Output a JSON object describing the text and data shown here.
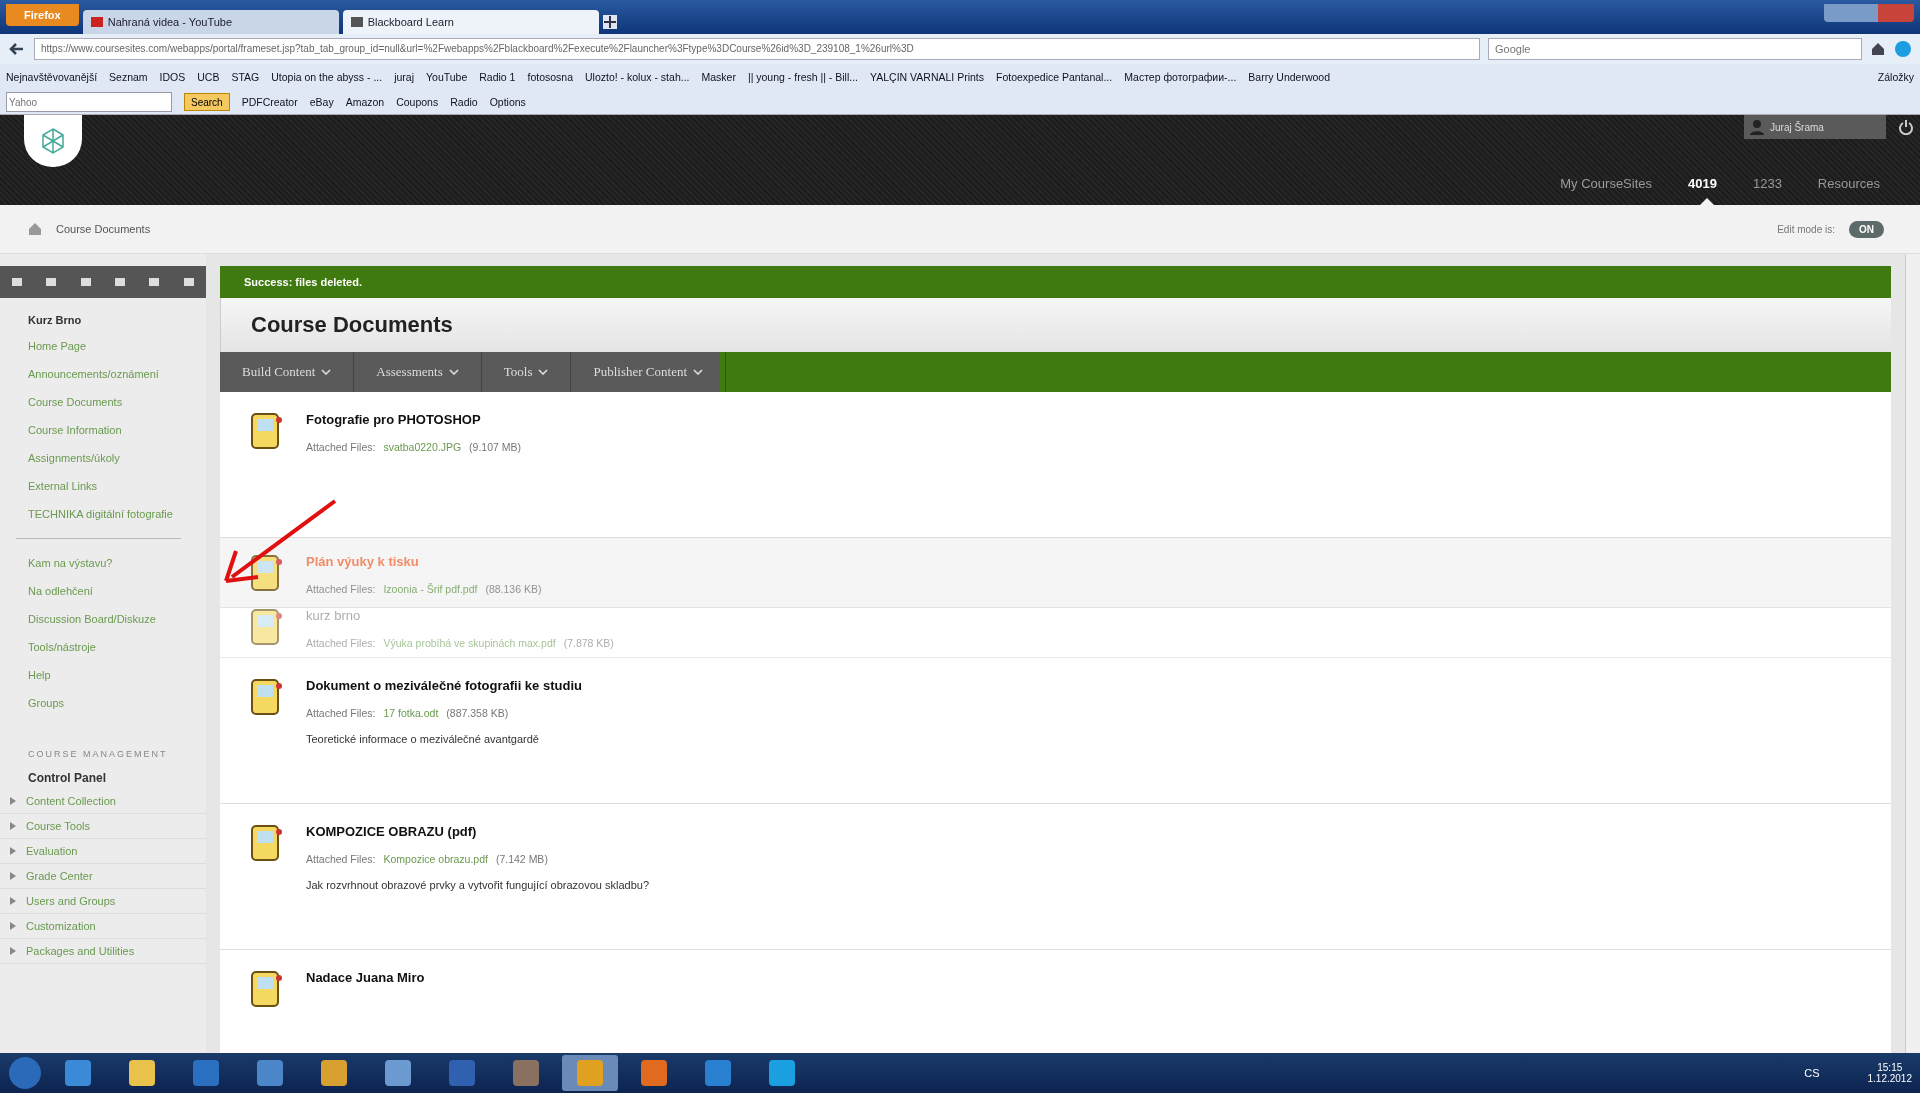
{
  "browser": {
    "menu_button": "Firefox",
    "tabs": [
      {
        "title": "Nahraná videa - YouTube",
        "selected": false
      },
      {
        "title": "Blackboard Learn",
        "selected": true
      }
    ],
    "url": "https://www.coursesites.com/webapps/portal/frameset.jsp?tab_tab_group_id=null&url=%2Fwebapps%2Fblackboard%2Fexecute%2Flauncher%3Ftype%3DCourse%26id%3D_239108_1%26url%3D",
    "search_placeholder": "Google",
    "bookmarks": [
      "Nejnavštěvovanější",
      "Seznam",
      "IDOS",
      "UCB",
      "STAG",
      "Utopia on the abyss - ...",
      "juraj",
      "YouTube",
      "Radio 1",
      "fotososna",
      "Ulozto! - kolux - stah...",
      "Masker",
      "|| young - fresh || - Bill...",
      "YALÇIN VARNALI Prints",
      "Fotoexpedice Pantanal...",
      "Мастер фотографии-...",
      "Barry Underwood"
    ],
    "bookmarks_more": "Záložky",
    "toolbar2": {
      "field_placeholder": "Yahoo",
      "search_button": "Search",
      "items": [
        "PDFCreator",
        "eBay",
        "Amazon",
        "Coupons",
        "Radio",
        "Options"
      ]
    }
  },
  "header": {
    "user": "Juraj Šrama",
    "nav": [
      {
        "label": "My CourseSites",
        "selected": false
      },
      {
        "label": "4019",
        "selected": true
      },
      {
        "label": "1233",
        "selected": false
      },
      {
        "label": "Resources",
        "selected": false
      }
    ]
  },
  "breadcrumb": "Course Documents",
  "edit_mode": {
    "label": "Edit mode is:",
    "value": "ON",
    "on": true
  },
  "sidebar": {
    "course": "Kurz Brno",
    "groups": [
      [
        "Home Page",
        "Announcements/oznámení",
        "Course Documents",
        "Course Information",
        "Assignments/úkoly",
        "External Links",
        "TECHNIKA digitální fotografie"
      ],
      [
        "Kam na výstavu?",
        "Na odlehčení",
        "Discussion Board/Diskuze",
        "Tools/nástroje",
        "Help",
        "Groups"
      ]
    ],
    "management_heading": "COURSE MANAGEMENT",
    "control_panel": "Control Panel",
    "panel_items": [
      "Content Collection",
      "Course Tools",
      "Evaluation",
      "Grade Center",
      "Users and Groups",
      "Customization",
      "Packages and Utilities"
    ]
  },
  "message": "Success: files deleted.",
  "page_title": "Course Documents",
  "actions": [
    "Build Content",
    "Assessments",
    "Tools",
    "Publisher Content"
  ],
  "items": [
    {
      "kind": "normal",
      "title": "Fotografie pro PHOTOSHOP",
      "files_label": "Attached Files:",
      "file": "svatba0220.JPG",
      "size": "(9.107 MB)"
    },
    {
      "kind": "dragged",
      "title": "Plán výuky k tisku",
      "files_label": "Attached Files:",
      "file": "Izoonia - Šrif pdf.pdf",
      "size": "(88.136 KB)"
    },
    {
      "kind": "covered",
      "title": "kurz brno",
      "files_label": "Attached Files:",
      "file": "Výuka probíhá ve skupinách max.pdf",
      "size": "(7.878 KB)"
    },
    {
      "kind": "normal",
      "title": "Dokument o meziválečné fotografii ke studiu",
      "files_label": "Attached Files:",
      "file": "17 fotka.odt",
      "size": "(887.358 KB)",
      "description": "Teoretické informace o meziválečné avantgardě"
    },
    {
      "kind": "normal",
      "title": "KOMPOZICE OBRAZU (pdf)",
      "files_label": "Attached Files:",
      "file": "Kompozice obrazu.pdf",
      "size": "(7.142 MB)",
      "description": "Jak rozvrhnout obrazové prvky a vytvořit fungující obrazovou skladbu?"
    },
    {
      "kind": "normal",
      "title": "Nadace Juana Miro"
    }
  ],
  "taskbar": {
    "apps": [
      {
        "selected": false
      },
      {
        "selected": false
      },
      {
        "selected": false
      },
      {
        "selected": false
      },
      {
        "selected": false
      },
      {
        "selected": false
      },
      {
        "selected": false
      },
      {
        "selected": false
      },
      {
        "selected": true
      },
      {
        "selected": false
      },
      {
        "selected": false
      },
      {
        "selected": false
      }
    ],
    "language": "CS",
    "time": "15:15",
    "date": "1.12.2012"
  }
}
